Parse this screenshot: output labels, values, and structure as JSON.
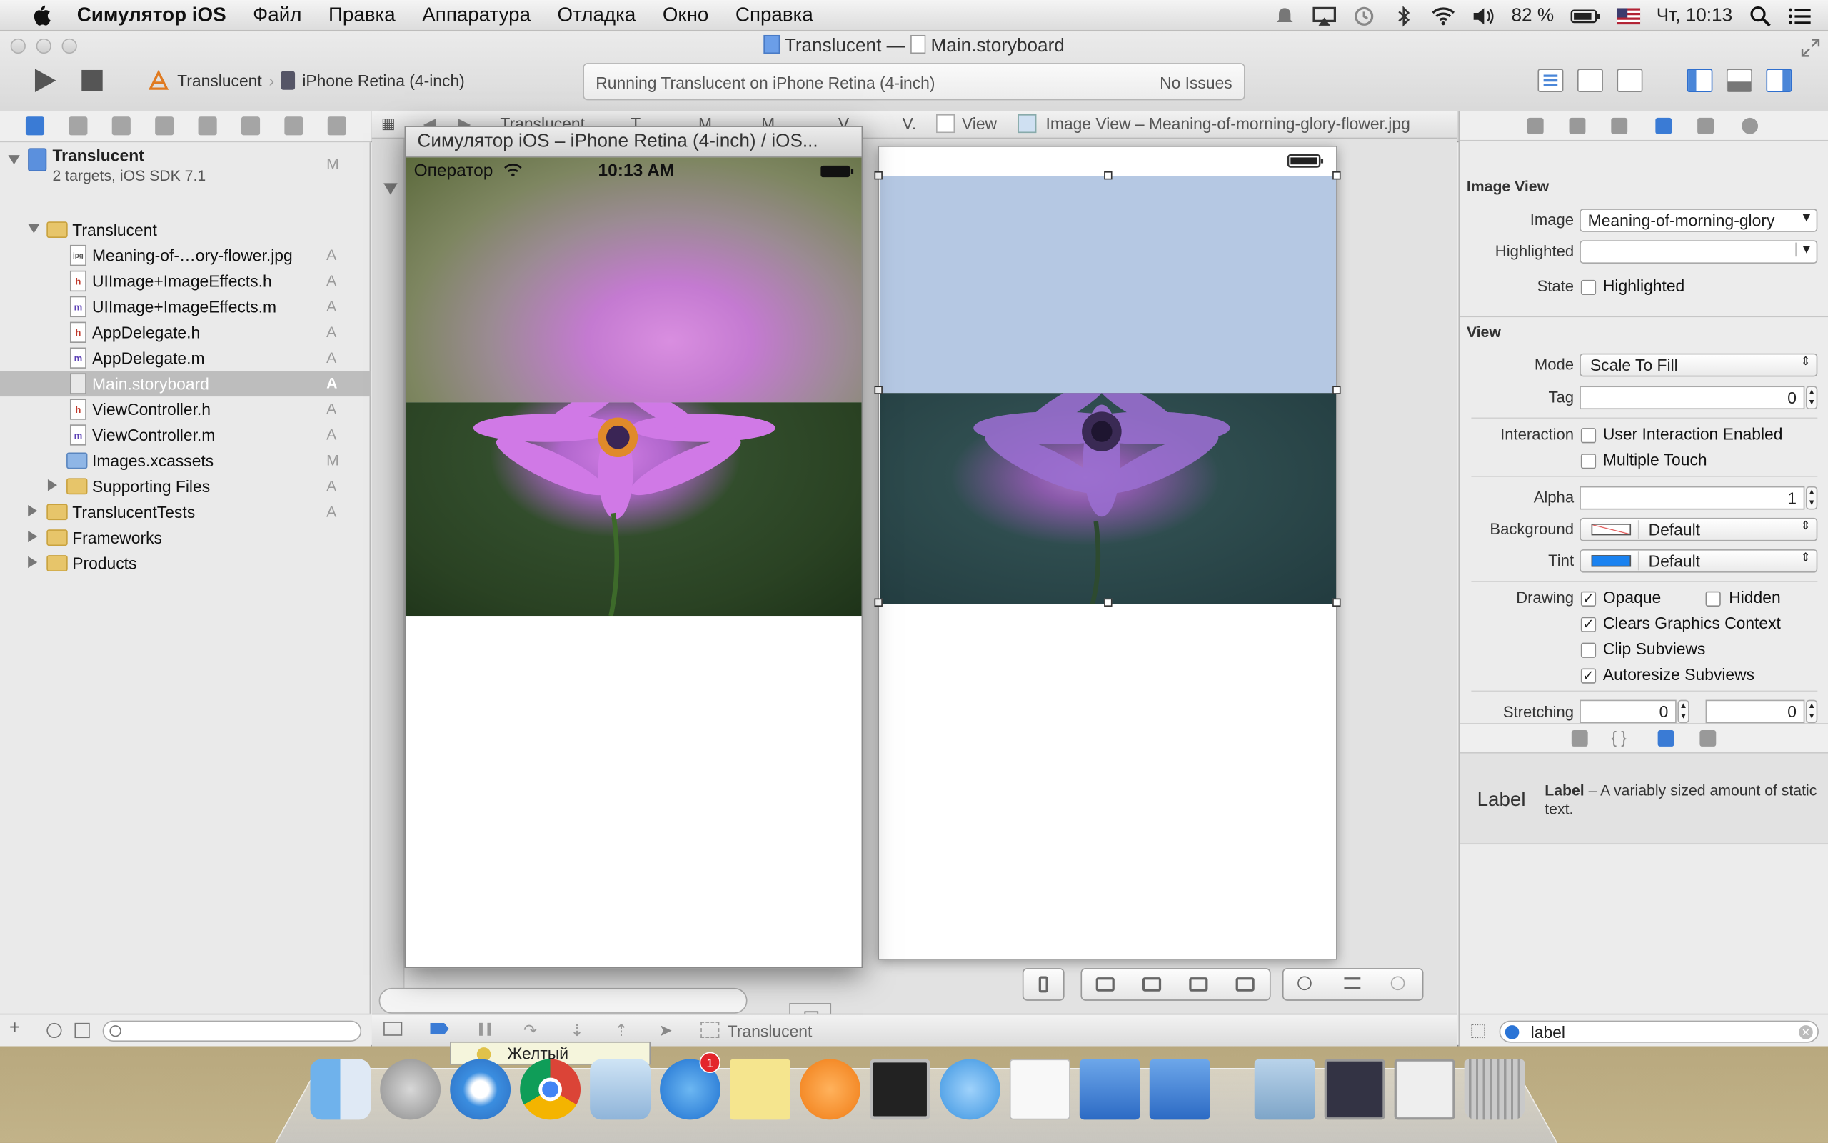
{
  "menubar": {
    "app_name": "Симулятор iOS",
    "items": [
      "Файл",
      "Правка",
      "Аппаратура",
      "Отладка",
      "Окно",
      "Справка"
    ],
    "battery": "82 %",
    "clock": "Чт, 10:13"
  },
  "window": {
    "title_project": "Translucent",
    "title_sep": "—",
    "title_file": "Main.storyboard",
    "scheme": "Translucent",
    "device": "iPhone Retina (4-inch)",
    "activity_status": "Running Translucent on iPhone Retina (4-inch)",
    "issues": "No Issues"
  },
  "navigator": {
    "project_name": "Translucent",
    "project_sub": "2 targets, iOS SDK 7.1",
    "project_status": "M",
    "rows": [
      {
        "label": "Translucent",
        "status": ""
      },
      {
        "label": "Meaning-of-…ory-flower.jpg",
        "status": "A"
      },
      {
        "label": "UIImage+ImageEffects.h",
        "status": "A"
      },
      {
        "label": "UIImage+ImageEffects.m",
        "status": "A"
      },
      {
        "label": "AppDelegate.h",
        "status": "A"
      },
      {
        "label": "AppDelegate.m",
        "status": "A"
      },
      {
        "label": "Main.storyboard",
        "status": "A"
      },
      {
        "label": "ViewController.h",
        "status": "A"
      },
      {
        "label": "ViewController.m",
        "status": "A"
      },
      {
        "label": "Images.xcassets",
        "status": "M"
      },
      {
        "label": "Supporting Files",
        "status": "A"
      },
      {
        "label": "TranslucentTests",
        "status": "A"
      },
      {
        "label": "Frameworks",
        "status": ""
      },
      {
        "label": "Products",
        "status": ""
      }
    ]
  },
  "jumpbar": {
    "items": [
      "Translucent",
      "T",
      "M",
      "M",
      "V",
      "V.",
      "View",
      "Image View – Meaning-of-morning-glory-flower.jpg"
    ]
  },
  "editor": {
    "debug_target": "Translucent"
  },
  "simulator": {
    "title": "Симулятор iOS – iPhone Retina (4-inch) / iOS...",
    "carrier": "Оператор",
    "time": "10:13 AM"
  },
  "inspector": {
    "image_view_title": "Image View",
    "image_label": "Image",
    "image_value": "Meaning-of-morning-glory",
    "highlighted_label": "Highlighted",
    "highlighted_value": "",
    "state_label": "State",
    "state_option": "Highlighted",
    "view_title": "View",
    "mode_label": "Mode",
    "mode_value": "Scale To Fill",
    "tag_label": "Tag",
    "tag_value": "0",
    "interaction_label": "Interaction",
    "user_interaction": "User Interaction Enabled",
    "multiple_touch": "Multiple Touch",
    "alpha_label": "Alpha",
    "alpha_value": "1",
    "background_label": "Background",
    "background_value": "Default",
    "tint_label": "Tint",
    "tint_value": "Default",
    "tint_color": "#1a82f0",
    "drawing_label": "Drawing",
    "opaque": "Opaque",
    "hidden": "Hidden",
    "clears_graphics": "Clears Graphics Context",
    "clip_subviews": "Clip Subviews",
    "autoresize_subviews": "Autoresize Subviews",
    "stretching_label": "Stretching",
    "stretch_x": "0",
    "stretch_y": "0",
    "library_item_icon_text": "Label",
    "library_item_title": "Label",
    "library_item_desc": " – A variably sized amount of static text.",
    "search_value": "label"
  },
  "dock": {
    "tooltip": "Желтый",
    "appstore_badge": "1",
    "apps": [
      "finder-icon",
      "launchpad-icon",
      "safari-icon",
      "chrome-icon",
      "mail-icon",
      "app-store-icon",
      "notes-icon",
      "ibooks-icon",
      "terminal-icon",
      "messages-icon",
      "preview-icon",
      "xcode-icon",
      "simulator-icon",
      "downloads-icon",
      "screens-icon",
      "trash-icon"
    ]
  }
}
